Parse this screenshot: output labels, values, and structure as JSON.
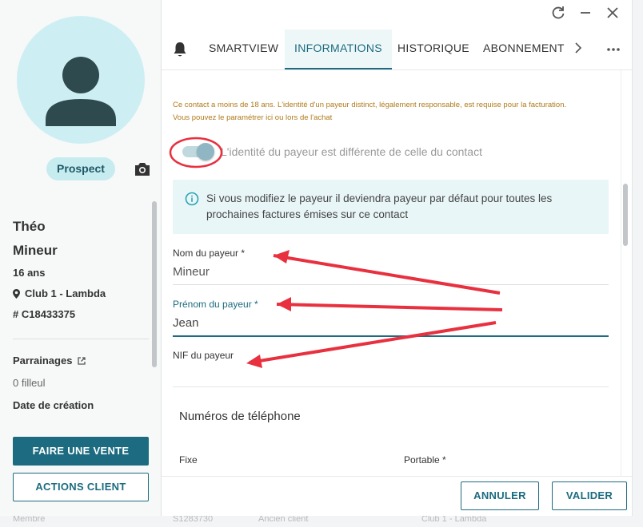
{
  "background": {
    "bottom_texts": [
      "Membre",
      "S1283730",
      "Ancien client",
      "Club 1 - Lambda"
    ]
  },
  "contact": {
    "status_badge": "Prospect",
    "first_name": "Théo",
    "last_name": "Mineur",
    "age": "16 ans",
    "club": "Club 1 - Lambda",
    "id": "# C18433375",
    "parrainages_label": "Parrainages",
    "filleul_count": "0 filleul",
    "date_creation_label": "Date de création"
  },
  "left_actions": {
    "sale_button": "FAIRE UNE VENTE",
    "client_actions_button": "ACTIONS CLIENT"
  },
  "tabs": [
    {
      "label": "SMARTVIEW",
      "active": false
    },
    {
      "label": "INFORMATIONS",
      "active": true
    },
    {
      "label": "HISTORIQUE",
      "active": false
    },
    {
      "label": "ABONNEMENT",
      "active": false
    }
  ],
  "form": {
    "warning_line1": "Ce contact a moins de 18 ans. L'identité d'un payeur distinct, légalement responsable, est requise pour la facturation.",
    "warning_line2": "Vous pouvez le paramétrer ici ou lors de l'achat",
    "toggle_label": "L'identité du payeur est différente de celle du contact",
    "toggle_on": true,
    "info_text": "Si vous modifiez le payeur il deviendra payeur par défaut pour toutes les prochaines factures émises sur ce contact",
    "payer_last_name_label": "Nom du payeur *",
    "payer_last_name_value": "Mineur",
    "payer_first_name_label": "Prénom du payeur *",
    "payer_first_name_value": "Jean",
    "payer_nif_label": "NIF du payeur",
    "payer_nif_value": "",
    "phones_title": "Numéros de téléphone",
    "fixe_label": "Fixe",
    "portable_label": "Portable *"
  },
  "footer": {
    "cancel_button": "ANNULER",
    "validate_button": "VALIDER"
  },
  "colors": {
    "accent": "#1c6b80",
    "annotation": "#e8303f",
    "warning": "#b07a1a",
    "info_bg": "#e9f6f7"
  },
  "icons": [
    "refresh-icon",
    "minimize-icon",
    "close-icon",
    "bell-icon",
    "chevron-right-icon",
    "more-icon",
    "camera-icon",
    "location-pin-icon",
    "external-link-icon",
    "info-icon"
  ]
}
